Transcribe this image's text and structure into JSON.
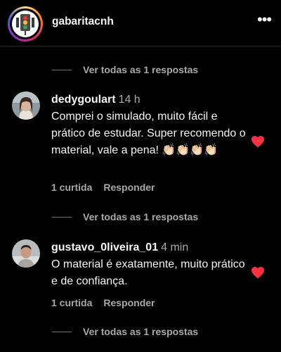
{
  "header": {
    "username": "gabaritacnh",
    "more_icon": "more-horizontal-icon"
  },
  "view_replies_label": "Ver todas as 1 respostas",
  "comments": [
    {
      "username": "dedygoulart",
      "time": "14 h",
      "text": "Comprei o simulado, muito fácil e prático de estudar. Super recomendo o material, vale a pena! 👏🏻👏🏻👏🏻👏🏻",
      "likes": "1 curtida",
      "reply_label": "Responder",
      "liked": true
    },
    {
      "username": "gustavo_0liveira_01",
      "time": "4 min",
      "text": "O material é exatamente, muito prático e de confiança.",
      "likes": "1 curtida",
      "reply_label": "Responder",
      "liked": true
    }
  ],
  "colors": {
    "background": "#000000",
    "text": "#f5f5f5",
    "muted": "#a8a8a8",
    "heart": "#ff3040"
  }
}
